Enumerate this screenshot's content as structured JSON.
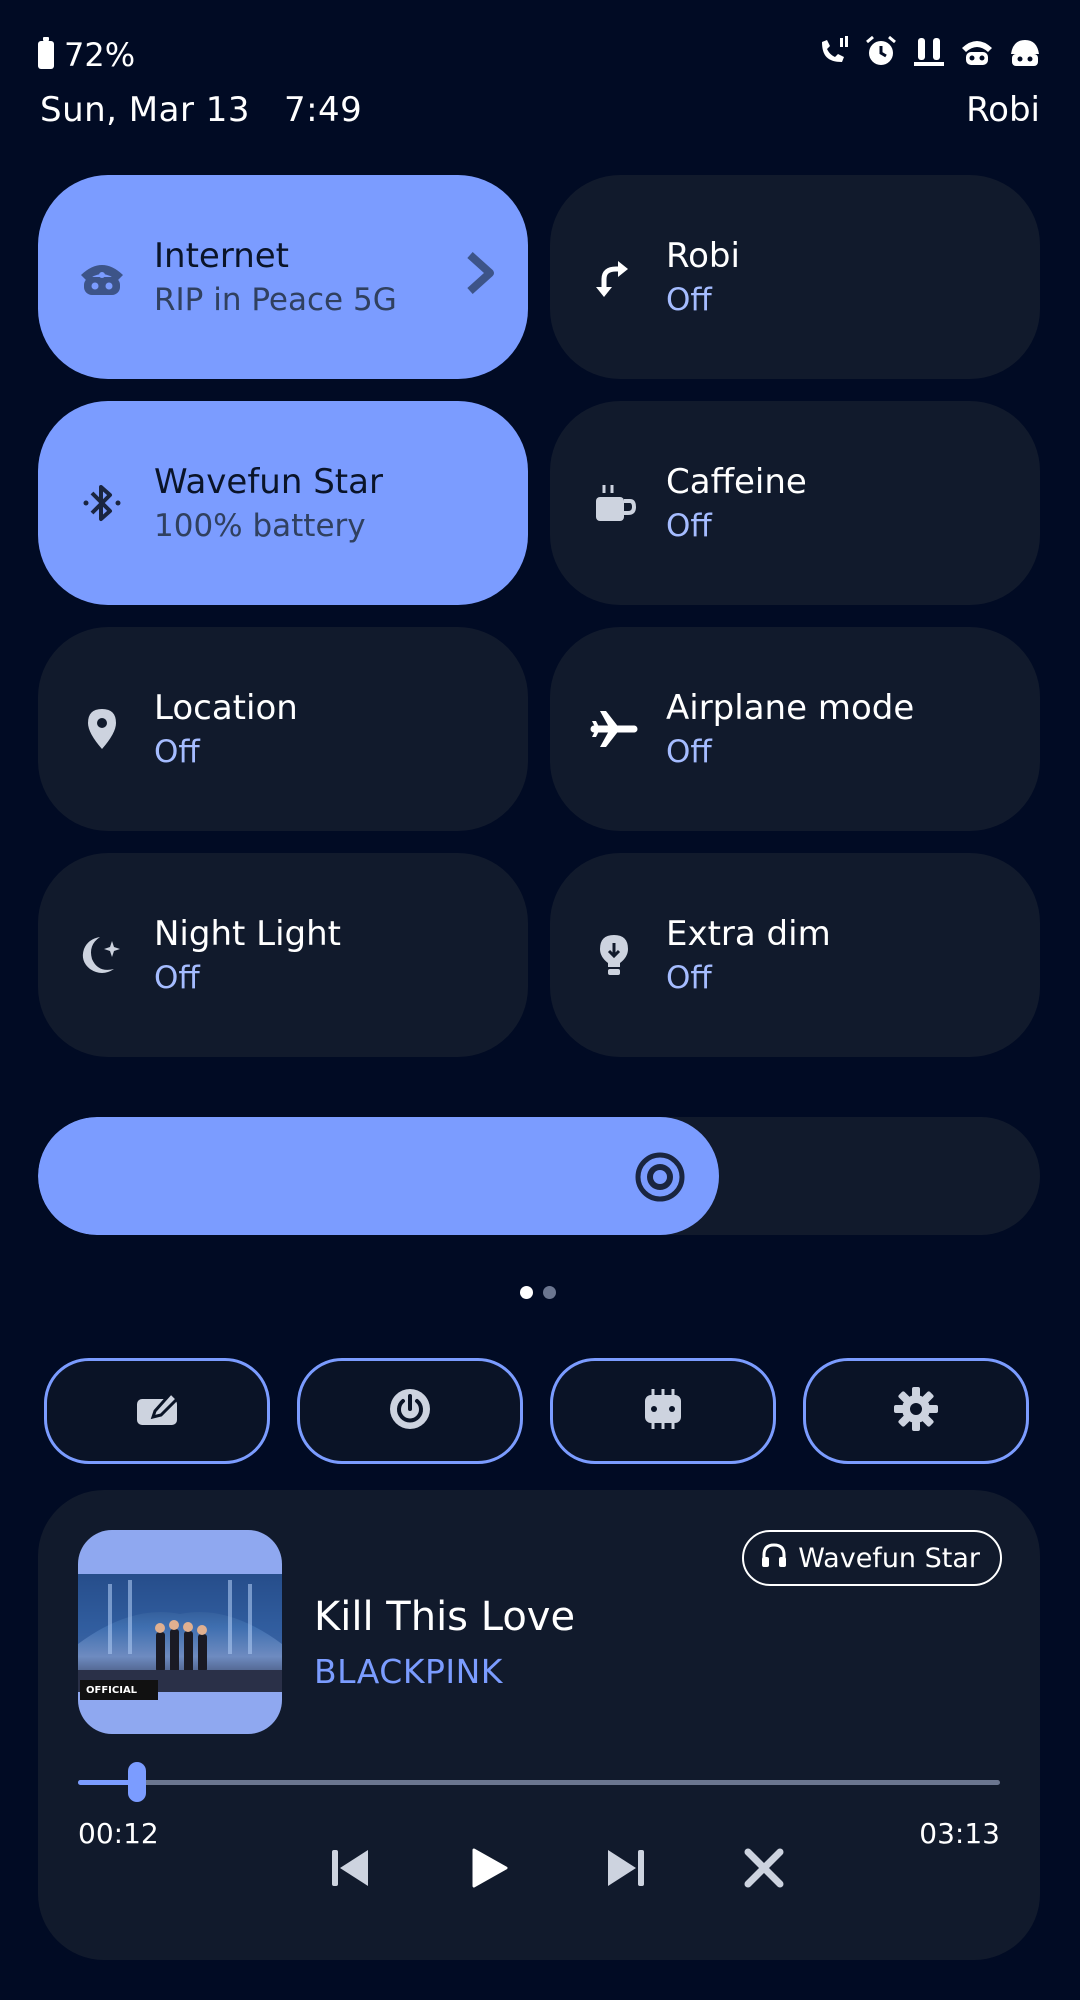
{
  "status_bar": {
    "battery_level": "72%",
    "icons": [
      "volte-call-icon",
      "alarm-icon",
      "earbuds-icon",
      "wifi-bluetooth-icon",
      "signal-icon"
    ]
  },
  "header": {
    "date": "Sun, Mar 13",
    "time": "7:49",
    "carrier": "Robi"
  },
  "tiles": [
    {
      "title": "Internet",
      "subtitle": "RIP in Peace 5G",
      "icon": "wifi-icon",
      "active": true
    },
    {
      "title": "Robi",
      "subtitle": "Off",
      "icon": "mobile-data-icon",
      "active": false
    },
    {
      "title": "Wavefun Star",
      "subtitle": "100% battery",
      "icon": "bluetooth-icon",
      "active": true
    },
    {
      "title": "Caffeine",
      "subtitle": "Off",
      "icon": "coffee-cup-icon",
      "active": false
    },
    {
      "title": "Location",
      "subtitle": "Off",
      "icon": "location-pin-icon",
      "active": false
    },
    {
      "title": "Airplane mode",
      "subtitle": "Off",
      "icon": "airplane-icon",
      "active": false
    },
    {
      "title": "Night Light",
      "subtitle": "Off",
      "icon": "moon-icon",
      "active": false
    },
    {
      "title": "Extra dim",
      "subtitle": "Off",
      "icon": "lightbulb-icon",
      "active": false
    }
  ],
  "brightness": {
    "level": 0.68,
    "icon": "brightness-icon"
  },
  "page_indicator": {
    "current": 1,
    "total": 2
  },
  "footer_buttons": [
    "edit-icon",
    "power-icon",
    "cpu-icon",
    "settings-icon"
  ],
  "media": {
    "title": "Kill This Love",
    "artist": "BLACKPINK",
    "output_device": "Wavefun Star",
    "elapsed": "00:12",
    "duration": "03:13",
    "progress": 0.064,
    "art_badge": "OFFICIAL",
    "colors": {
      "accent": "#7b9cff",
      "card": "#111a2c",
      "background": "#010b24"
    }
  }
}
